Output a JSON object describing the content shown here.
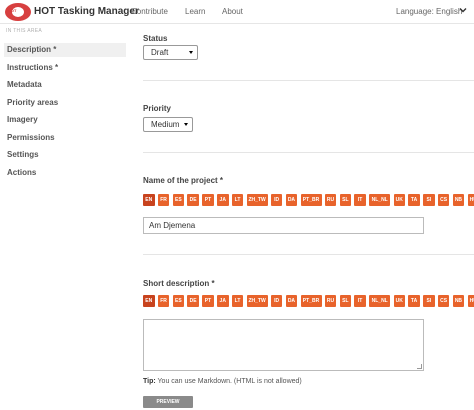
{
  "header": {
    "logo_text": "HOT",
    "brand": "HOT Tasking Manager",
    "nav": [
      "Contribute",
      "Learn",
      "About"
    ],
    "language": "Language: English"
  },
  "sidebar": {
    "heading": "IN THIS AREA",
    "items": [
      "Description *",
      "Instructions *",
      "Metadata",
      "Priority areas",
      "Imagery",
      "Permissions",
      "Settings",
      "Actions"
    ],
    "active": "Description *"
  },
  "form": {
    "status_label": "Status",
    "status_value": "Draft",
    "priority_label": "Priority",
    "priority_value": "Medium",
    "name_label": "Name of the project *",
    "name_value": "Am Djemena",
    "short_desc_label": "Short description *",
    "short_desc_value": "",
    "tip_label": "Tip:",
    "tip_text": "You can use Markdown. (HTML is not allowed)",
    "preview_label": "PREVIEW"
  },
  "languages": [
    "EN",
    "FR",
    "ES",
    "DE",
    "PT",
    "JA",
    "LT",
    "ZH_TW",
    "ID",
    "DA",
    "PT_BR",
    "RU",
    "SL",
    "IT",
    "NL_NL",
    "UK",
    "TA",
    "SI",
    "CS",
    "NB",
    "HU"
  ],
  "active_language": "EN",
  "colors": {
    "accent": "#e8632b",
    "accent_active": "#c8431e",
    "brand": "#d73f3f",
    "preview_button": "#8a8a8a"
  }
}
